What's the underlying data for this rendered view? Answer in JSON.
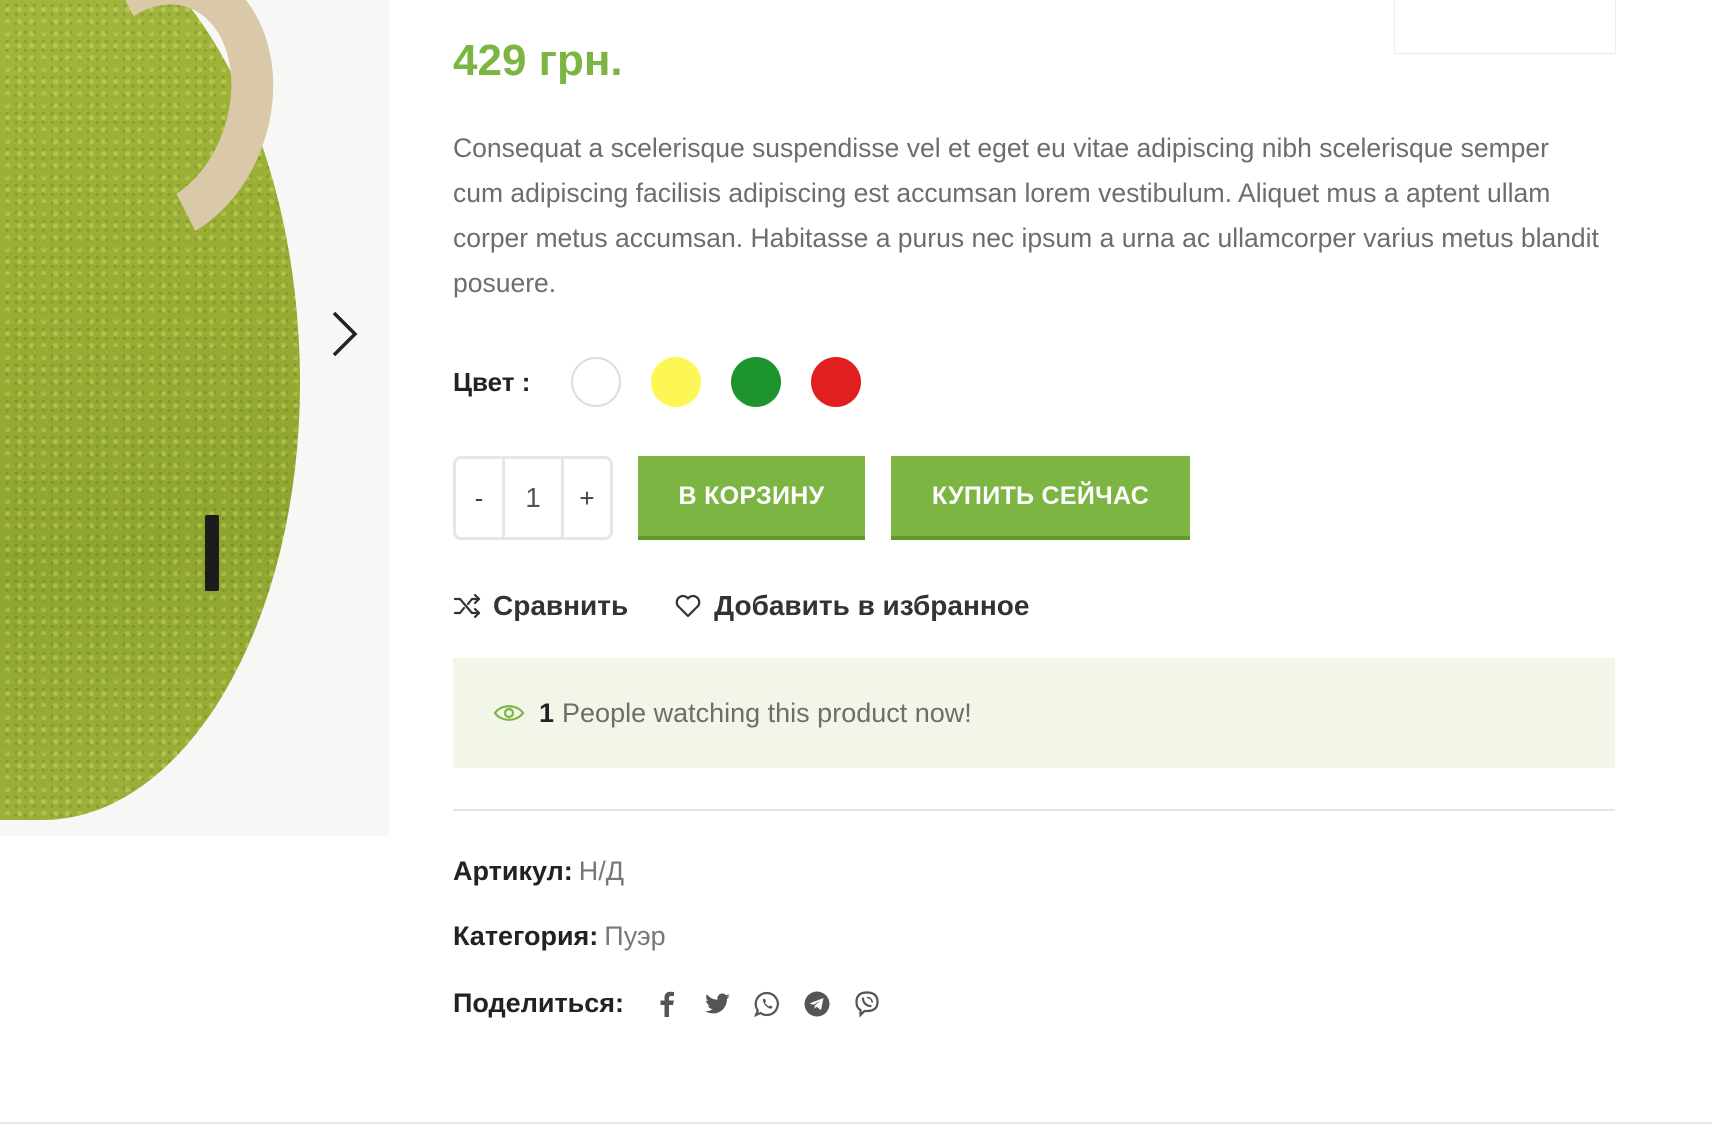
{
  "product": {
    "price": "429 грн.",
    "description": "Consequat a scelerisque suspendisse vel et eget eu vitae adipiscing nibh scelerisque semper cum adipiscing facilisis adipiscing est accumsan lorem vestibulum. Aliquet mus a aptent ullam corper metus accumsan. Habitasse a purus nec ipsum a urna ac ullamcorper varius metus blandit posuere."
  },
  "gallery": {
    "next_icon": "chevron-right-icon"
  },
  "color": {
    "label": "Цвет :",
    "swatches": [
      {
        "name": "white",
        "hex": "#ffffff"
      },
      {
        "name": "yellow",
        "hex": "#fcf754"
      },
      {
        "name": "green",
        "hex": "#1e942e"
      },
      {
        "name": "red",
        "hex": "#e11f1f"
      }
    ]
  },
  "quantity": {
    "minus": "-",
    "value": "1",
    "plus": "+"
  },
  "buttons": {
    "add_to_cart": "В КОРЗИНУ",
    "buy_now": "КУПИТЬ СЕЙЧАС"
  },
  "actions": {
    "compare": "Сравнить",
    "compare_icon": "shuffle-icon",
    "wishlist": "Добавить в избранное",
    "wishlist_icon": "heart-icon"
  },
  "watching": {
    "icon": "eye-icon",
    "count": "1",
    "message": "People watching this product now!"
  },
  "meta": {
    "sku_label": "Артикул:",
    "sku_value": "Н/Д",
    "category_label": "Категория:",
    "category_value": "Пуэр",
    "share_label": "Поделиться:",
    "share_icons": [
      "facebook-icon",
      "twitter-icon",
      "whatsapp-icon",
      "telegram-icon",
      "viber-icon"
    ]
  },
  "colors": {
    "accent": "#7cb542",
    "accent_dark": "#5f9a2c",
    "notice_bg": "#f2f6e9"
  }
}
